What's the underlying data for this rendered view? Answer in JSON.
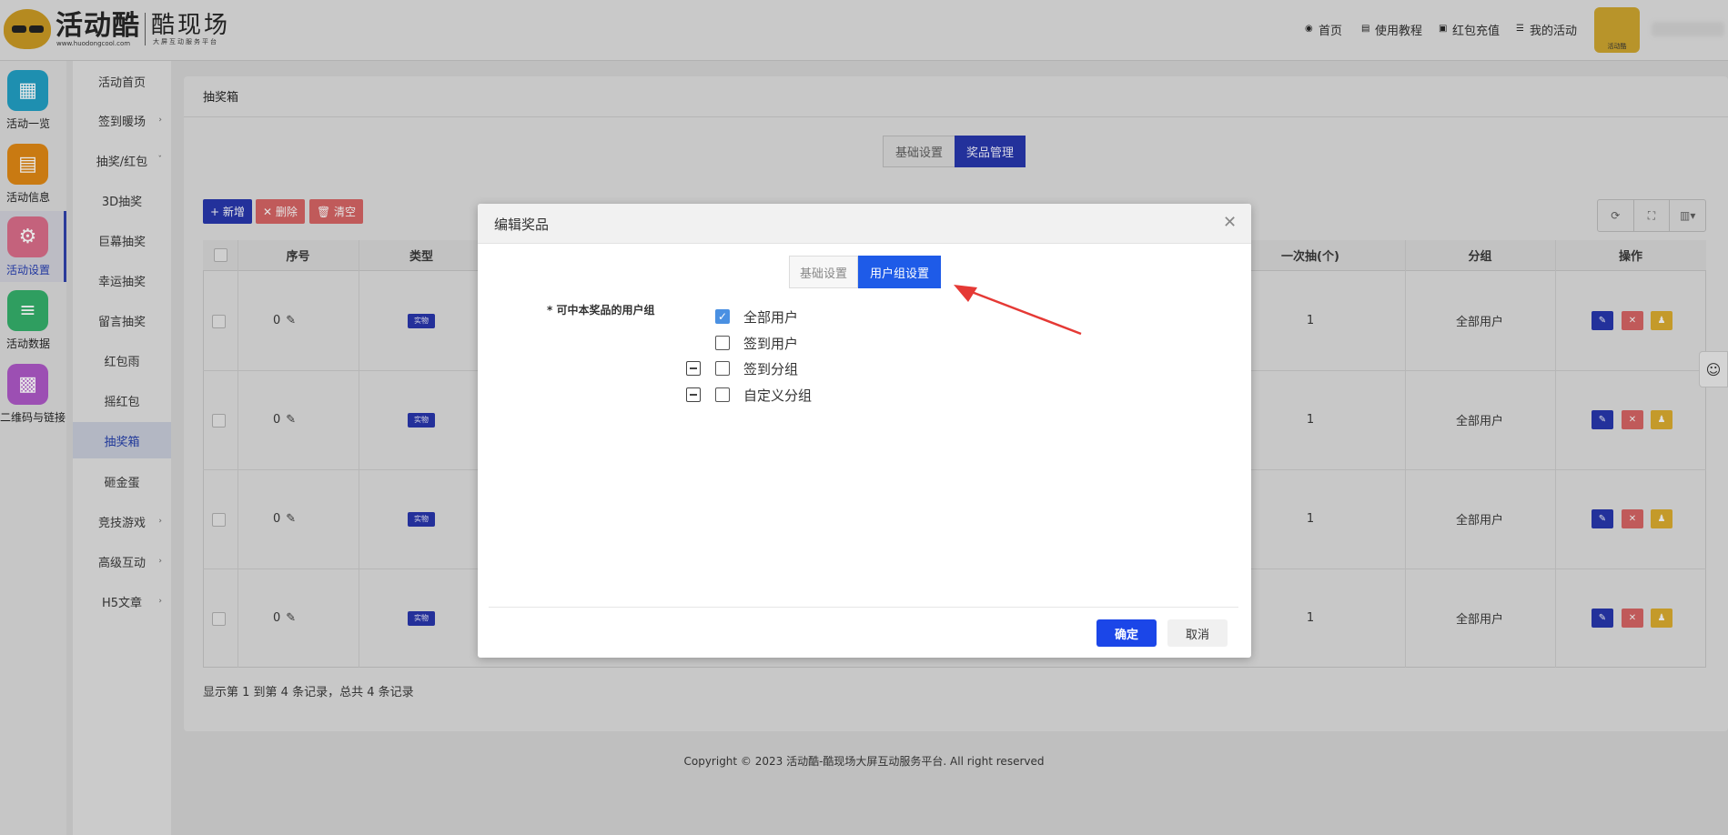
{
  "header": {
    "brand": "活动酷",
    "url": "www.huodongcool.com",
    "brand2": "酷现场",
    "tagline": "大屏互动服务平台",
    "nav": [
      {
        "icon": "home-icon",
        "label": "首页"
      },
      {
        "icon": "book-icon",
        "label": "使用教程"
      },
      {
        "icon": "wallet-icon",
        "label": "红包充值"
      },
      {
        "icon": "list-icon",
        "label": "我的活动"
      }
    ],
    "avatar_caption": "活动酷"
  },
  "rail": {
    "items": [
      {
        "icon": "grid-icon",
        "label": "活动一览",
        "color": "#1e8fb0"
      },
      {
        "icon": "document-icon",
        "label": "活动信息",
        "color": "#c97a12"
      },
      {
        "icon": "gear-icon",
        "label": "活动设置",
        "color": "#c4627c"
      },
      {
        "icon": "database-icon",
        "label": "活动数据",
        "color": "#2f9e60"
      },
      {
        "icon": "qrcode-icon",
        "label": "二维码与链接",
        "color": "#9c4fb3"
      }
    ]
  },
  "subnav": {
    "items": [
      {
        "label": "活动首页",
        "arrow": ""
      },
      {
        "label": "签到暖场",
        "arrow": "›"
      },
      {
        "label": "抽奖/红包",
        "arrow": "ˇ"
      },
      {
        "label": "3D抽奖",
        "arrow": ""
      },
      {
        "label": "巨幕抽奖",
        "arrow": ""
      },
      {
        "label": "幸运抽奖",
        "arrow": ""
      },
      {
        "label": "留言抽奖",
        "arrow": ""
      },
      {
        "label": "红包雨",
        "arrow": ""
      },
      {
        "label": "摇红包",
        "arrow": ""
      },
      {
        "label": "抽奖箱",
        "arrow": ""
      },
      {
        "label": "砸金蛋",
        "arrow": ""
      },
      {
        "label": "竞技游戏",
        "arrow": "›"
      },
      {
        "label": "高级互动",
        "arrow": "›"
      },
      {
        "label": "H5文章",
        "arrow": "›"
      }
    ]
  },
  "main": {
    "breadcrumb": "抽奖箱",
    "tabs": [
      "基础设置",
      "奖品管理"
    ],
    "toolbar": {
      "add": "+ 新增",
      "delete": "✕ 删除",
      "clear": "🗑 清空"
    },
    "columns": [
      "序号",
      "类型",
      "一次抽(个)",
      "分组",
      "操作"
    ],
    "rows": [
      {
        "index": "0",
        "type": "实物",
        "count": "1",
        "group": "全部用户"
      },
      {
        "index": "0",
        "type": "实物",
        "count": "1",
        "group": "全部用户"
      },
      {
        "index": "0",
        "type": "实物",
        "count": "1",
        "group": "全部用户"
      },
      {
        "index": "0",
        "type": "实物",
        "count": "1",
        "group": "全部用户"
      }
    ],
    "footer_info": "显示第 1 到第 4 条记录，总共 4 条记录"
  },
  "copyright": "Copyright © 2023 活动酷-酷现场大屏互动服务平台. All right reserved",
  "modal": {
    "title": "编辑奖品",
    "tabs": [
      "基础设置",
      "用户组设置"
    ],
    "field_label": "* 可中本奖品的用户组",
    "options": [
      {
        "label": "全部用户",
        "checked": true,
        "collapsible": false
      },
      {
        "label": "签到用户",
        "checked": false,
        "collapsible": false
      },
      {
        "label": "签到分组",
        "checked": false,
        "collapsible": true
      },
      {
        "label": "自定义分组",
        "checked": false,
        "collapsible": true
      }
    ],
    "ok": "确定",
    "cancel": "取消"
  },
  "colors": {
    "primary": "#1e5be8",
    "overlay_primary": "#23319b",
    "danger": "#e06464",
    "warning": "#d4a32a",
    "arrow": "#e53935"
  }
}
